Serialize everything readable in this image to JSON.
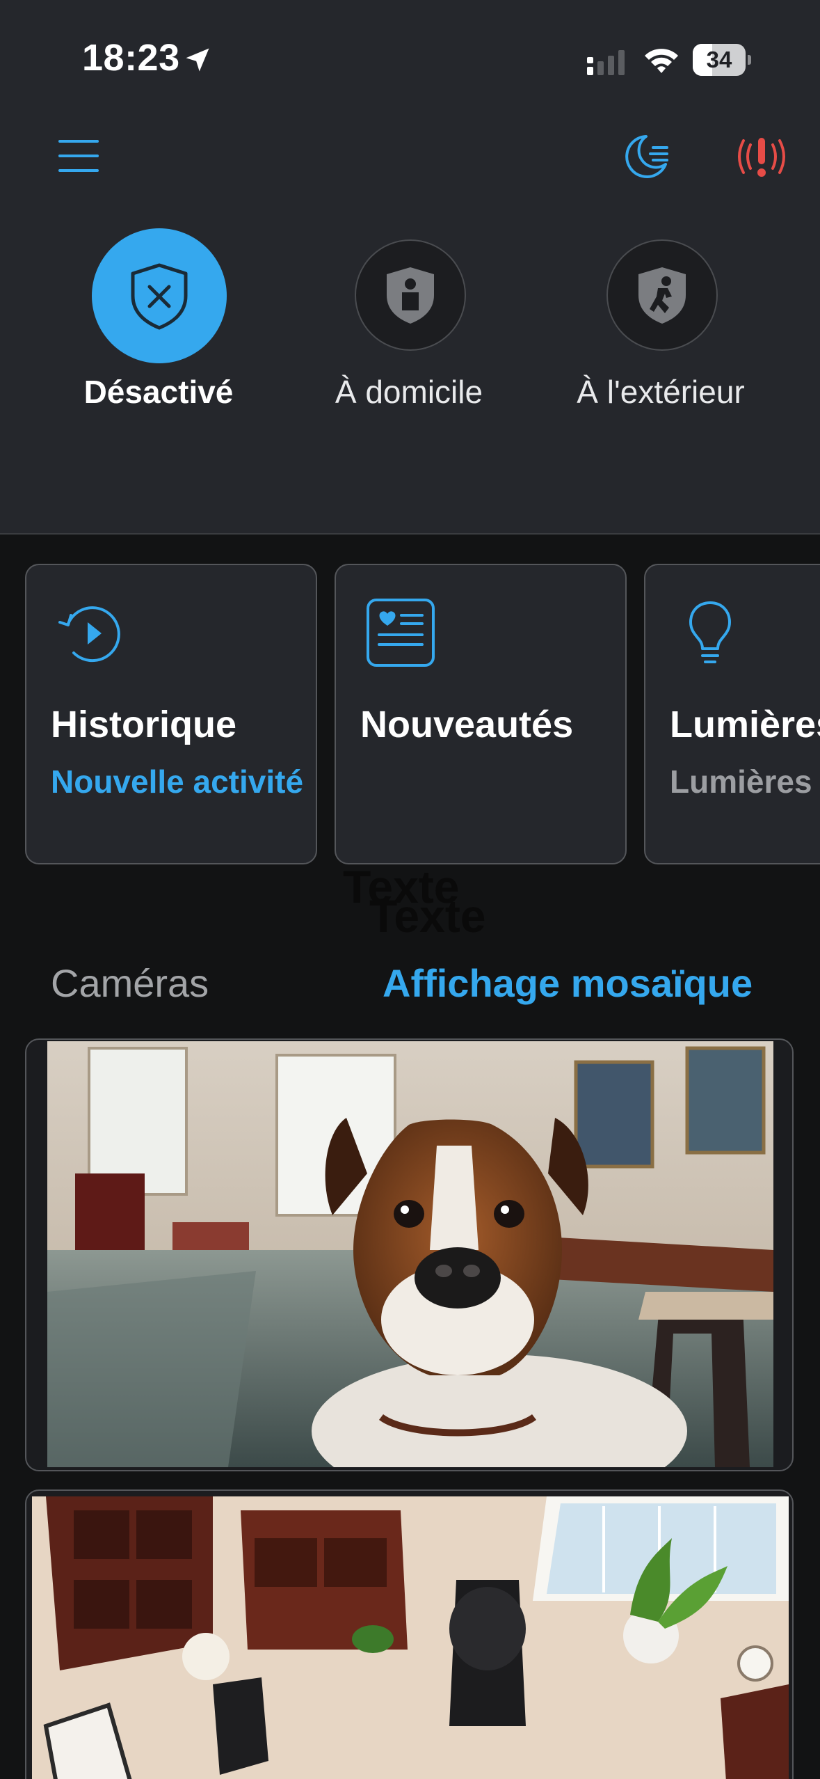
{
  "status_bar": {
    "time": "18:23",
    "battery": "34",
    "icons": [
      "location-arrow-icon",
      "cellular-signal-icon",
      "wifi-icon",
      "battery-icon"
    ]
  },
  "toolbar": {
    "icons": [
      "menu-icon",
      "night-mode-icon",
      "alarm-alert-icon"
    ],
    "alert_color": "#e74c47"
  },
  "modes": [
    {
      "label": "Désactivé",
      "icon": "shield-x-icon",
      "selected": true
    },
    {
      "label": "À domicile",
      "icon": "shield-person-icon",
      "selected": false
    },
    {
      "label": "À l'extérieur",
      "icon": "shield-running-icon",
      "selected": false
    }
  ],
  "tiles": [
    {
      "title": "Historique",
      "subtitle": "Nouvelle activité",
      "icon": "history-play-icon"
    },
    {
      "title": "Nouveautés",
      "subtitle": "",
      "icon": "news-card-icon"
    },
    {
      "title": "Lumières",
      "subtitle": "Lumières éteintes",
      "icon": "lightbulb-icon"
    }
  ],
  "overlay_text": [
    "Texte",
    "Texte"
  ],
  "cameras": {
    "section_title": "Caméras",
    "view_link": "Affichage mosaïque",
    "feeds": [
      {
        "icon": "camera-feed-dog-living-room"
      },
      {
        "icon": "camera-feed-office-overhead"
      }
    ]
  },
  "colors": {
    "accent": "#35a8ee",
    "header_bg": "#25272c",
    "page_bg": "#121314",
    "tile_border": "#54565a"
  }
}
